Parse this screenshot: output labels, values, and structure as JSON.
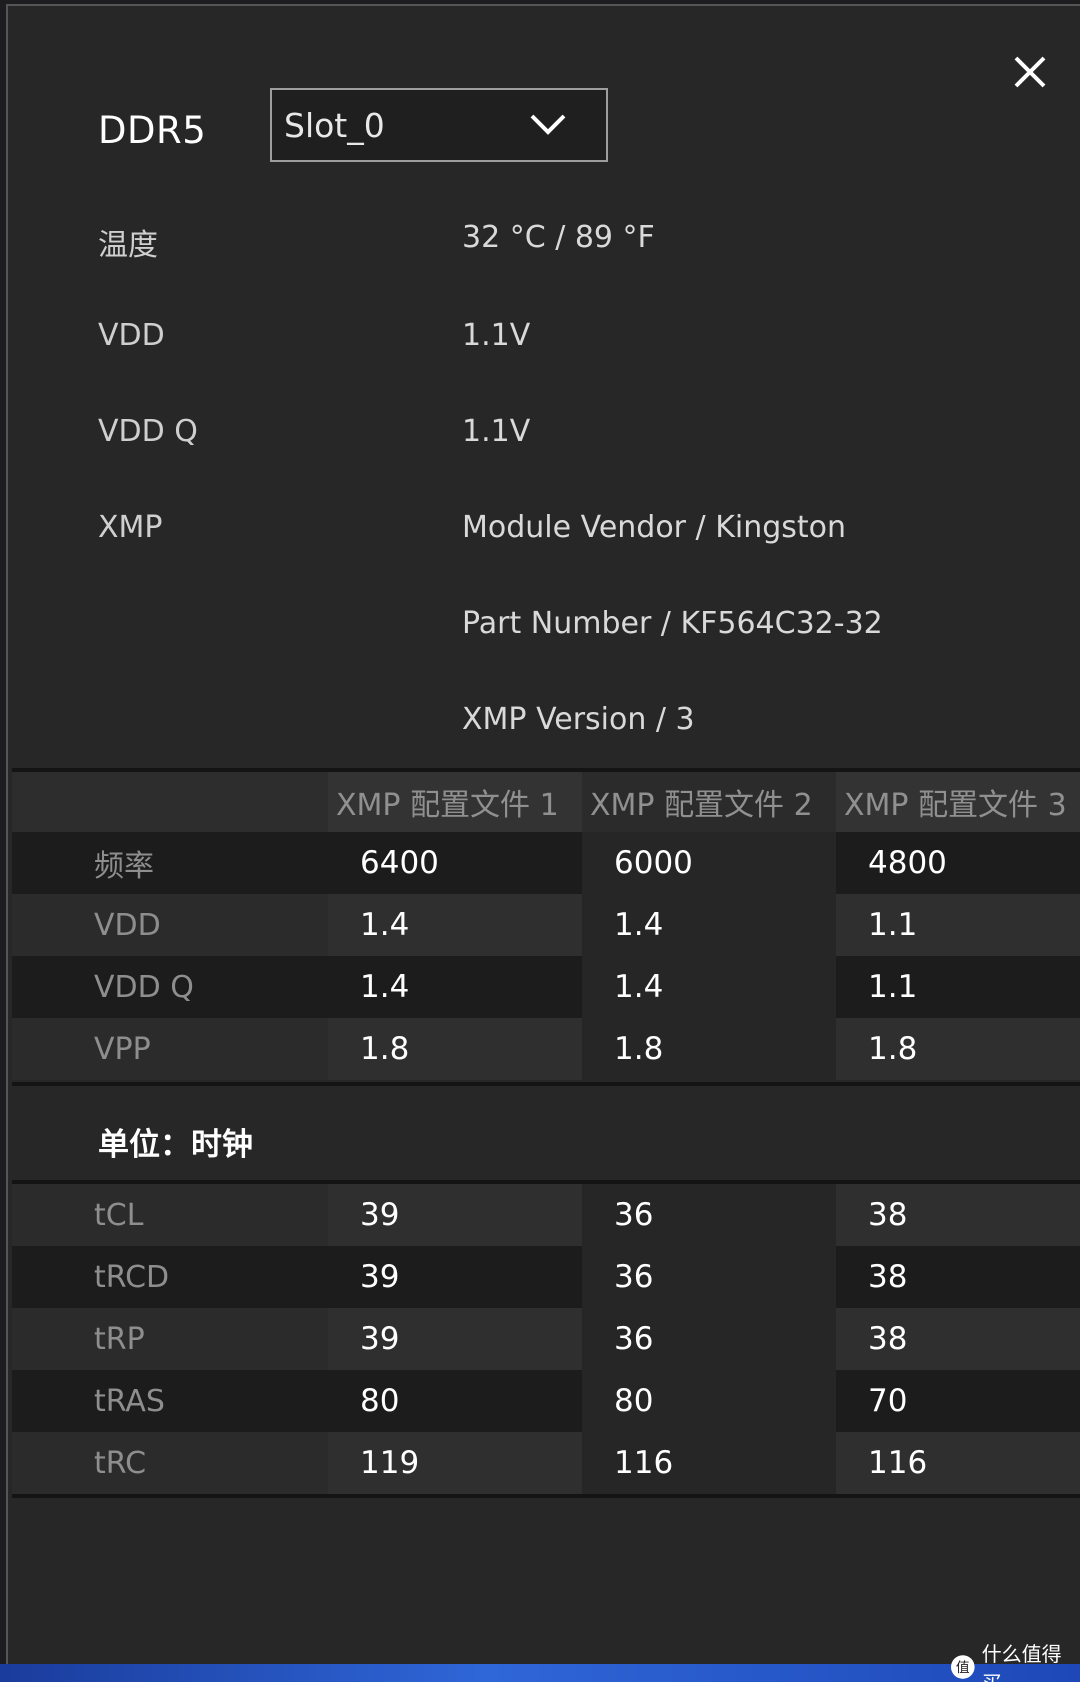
{
  "header": {
    "title": "DDR5",
    "slot_value": "Slot_0"
  },
  "info": [
    {
      "label": "温度",
      "value": "32 °C / 89 °F"
    },
    {
      "label": "VDD",
      "value": "1.1V"
    },
    {
      "label": "VDD Q",
      "value": "1.1V"
    },
    {
      "label": "XMP",
      "value": "Module Vendor / Kingston"
    },
    {
      "label": "",
      "value": "Part Number / KF564C32-32"
    },
    {
      "label": "",
      "value": "XMP Version / 3"
    }
  ],
  "profiles": {
    "headers": [
      "XMP 配置文件 1",
      "XMP 配置文件 2",
      "XMP 配置文件 3"
    ]
  },
  "voltage_table": [
    {
      "label": "频率",
      "values": [
        "6400",
        "6000",
        "4800"
      ]
    },
    {
      "label": "VDD",
      "values": [
        "1.4",
        "1.4",
        "1.1"
      ]
    },
    {
      "label": "VDD Q",
      "values": [
        "1.4",
        "1.4",
        "1.1"
      ]
    },
    {
      "label": "VPP",
      "values": [
        "1.8",
        "1.8",
        "1.8"
      ]
    }
  ],
  "units_label": "单位：时钟",
  "timing_table": [
    {
      "label": "tCL",
      "values": [
        "39",
        "36",
        "38"
      ]
    },
    {
      "label": "tRCD",
      "values": [
        "39",
        "36",
        "38"
      ]
    },
    {
      "label": "tRP",
      "values": [
        "39",
        "36",
        "38"
      ]
    },
    {
      "label": "tRAS",
      "values": [
        "80",
        "80",
        "70"
      ]
    },
    {
      "label": "tRC",
      "values": [
        "119",
        "116",
        "116"
      ]
    }
  ],
  "watermark": "什么值得买"
}
